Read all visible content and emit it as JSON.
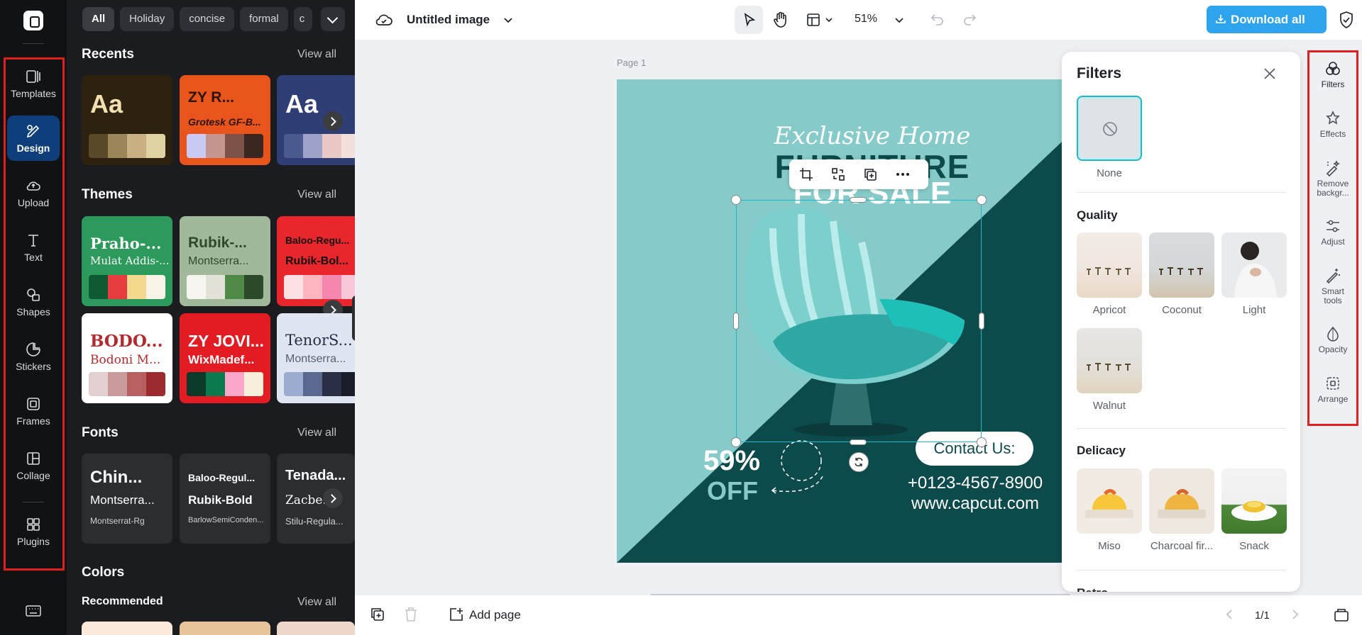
{
  "rail": {
    "items": [
      {
        "label": "Templates",
        "icon": "templates-icon"
      },
      {
        "label": "Design",
        "icon": "design-icon"
      },
      {
        "label": "Upload",
        "icon": "upload-icon"
      },
      {
        "label": "Text",
        "icon": "text-icon"
      },
      {
        "label": "Shapes",
        "icon": "shapes-icon"
      },
      {
        "label": "Stickers",
        "icon": "stickers-icon"
      },
      {
        "label": "Frames",
        "icon": "frames-icon"
      },
      {
        "label": "Collage",
        "icon": "collage-icon"
      },
      {
        "label": "Plugins",
        "icon": "plugins-icon"
      }
    ],
    "active": "Design"
  },
  "panel": {
    "chips": [
      "All",
      "Holiday",
      "concise",
      "formal",
      "c"
    ],
    "recents": {
      "title": "Recents",
      "view_all": "View all",
      "cards": [
        {
          "name": "Aa",
          "bg": "#2c220f",
          "colors": [
            "#5a4a2a",
            "#9c8558",
            "#c8b083",
            "#dfd2a3"
          ]
        },
        {
          "name": "ZY R...",
          "sub": "Grotesk GF-B...",
          "bg": "#e8541b",
          "colors": [
            "#c9cbf5",
            "#c4968d",
            "#7c5249",
            "#3a2720"
          ]
        },
        {
          "name": "Aa",
          "bg": "#2f3f76",
          "colors": [
            "#4b5a8e",
            "#9da3c8",
            "#e8c8c4",
            "#f3e0dc"
          ]
        }
      ]
    },
    "themes": {
      "title": "Themes",
      "view_all": "View all",
      "cards": [
        {
          "name": "Praho-...",
          "sub": "Mulat Addis-...",
          "bg": "#2c9a5a",
          "fg": "#fff",
          "colors": [
            "#0e5a33",
            "#e73c3f",
            "#f2d98e",
            "#f7f3e6"
          ]
        },
        {
          "name": "Rubik-...",
          "sub": "Montserra...",
          "bg": "#a2b89a",
          "fg": "#2e4a2a",
          "colors": [
            "#f7f5ef",
            "#e3e0d6",
            "#4f8a48",
            "#2a4a2a"
          ]
        },
        {
          "name": "Baloo-Regu...",
          "sub": "Rubik-Bol...",
          "bg": "#e8262b",
          "fg": "#111",
          "colors": [
            "#fde0e4",
            "#fbb6c0",
            "#f486b0",
            "#f8c8d8"
          ]
        },
        {
          "name": "BODO...",
          "sub": "Bodoni M...",
          "bg": "#ffffff",
          "fg": "#b22a2e",
          "colors": [
            "#e2cfcf",
            "#c99a9a",
            "#b85f62",
            "#9c2a2f"
          ]
        },
        {
          "name": "ZY JOVI...",
          "sub": "WixMadef...",
          "bg": "#e31b22",
          "fg": "#fff",
          "colors": [
            "#0b3a2a",
            "#0c7a4f",
            "#f9a8c9",
            "#f5efdc"
          ]
        },
        {
          "name": "TenorS...",
          "sub": "Montserra...",
          "bg": "#dfe6f2",
          "fg": "#2a2f45",
          "colors": [
            "#9cabd0",
            "#5a6890",
            "#2a2f45",
            "#1a1d2a"
          ]
        }
      ]
    },
    "fonts": {
      "title": "Fonts",
      "view_all": "View all",
      "cards": [
        {
          "l1": "Chin...",
          "l2": "Montserra...",
          "l3": "Montserrat-Rg"
        },
        {
          "l1": "Baloo-Regul...",
          "l2": "Rubik-Bold",
          "l3": "BarlowSemiConden..."
        },
        {
          "l1": "Tenada...",
          "l2": "Zacbe...",
          "l3": "Stilu-Regula..."
        }
      ]
    },
    "colors": {
      "title": "Colors"
    },
    "recommended": {
      "title": "Recommended",
      "view_all": "View all",
      "swatches": [
        "#fbeadb",
        "#e7c49a",
        "#edd6cc"
      ]
    }
  },
  "topbar": {
    "title": "Untitled image",
    "zoom": "51%",
    "download": "Download all"
  },
  "canvas": {
    "page_label": "Page 1",
    "design": {
      "headline_script": "Exclusive Home",
      "headline_main": "FURNITURE",
      "headline_sub": "FOR SALE",
      "discount": "59%",
      "off": "OFF",
      "contact": "Contact Us:",
      "phone": "+0123-4567-8900",
      "website": "www.capcut.com"
    }
  },
  "bottombar": {
    "add_page": "Add page",
    "pager": "1/1"
  },
  "filters": {
    "title": "Filters",
    "none_label": "None",
    "sections": [
      {
        "title": "Quality",
        "items": [
          "Apricot",
          "Coconut",
          "Light",
          "Walnut"
        ]
      },
      {
        "title": "Delicacy",
        "items": [
          "Miso",
          "Charcoal fir...",
          "Snack"
        ]
      },
      {
        "title": "Retro"
      }
    ]
  },
  "rightbar": {
    "items": [
      {
        "label": "Filters"
      },
      {
        "label": "Effects"
      },
      {
        "label": "Remove backgr..."
      },
      {
        "label": "Adjust"
      },
      {
        "label": "Smart tools"
      },
      {
        "label": "Opacity"
      },
      {
        "label": "Arrange"
      }
    ]
  },
  "colors": {
    "accent": "#2ea3ee",
    "highlight_box": "#e0201e",
    "design_teal": "#86cbc9",
    "design_dark": "#0d4a4b",
    "selection": "#1fb8c9"
  }
}
